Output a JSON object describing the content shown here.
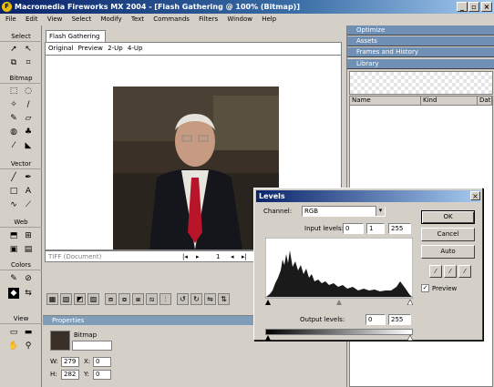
{
  "window": {
    "title": "Macromedia Fireworks MX 2004 - [Flash Gathering @ 100% (Bitmap)]",
    "minimize": "_",
    "restore": "▫",
    "close": "×"
  },
  "menu": [
    "File",
    "Edit",
    "View",
    "Select",
    "Modify",
    "Text",
    "Commands",
    "Filters",
    "Window",
    "Help"
  ],
  "tools": {
    "select": "Select",
    "bitmap": "Bitmap",
    "vector": "Vector",
    "web": "Web",
    "colors": "Colors",
    "view": "View"
  },
  "document": {
    "tab": "Flash Gathering",
    "views": [
      "Original",
      "Preview",
      "2-Up",
      "4-Up"
    ],
    "status_format": "TIFF (Document)",
    "page_number": "1"
  },
  "properties": {
    "header": "Properties",
    "object_type": "Bitmap",
    "w_label": "W:",
    "w_value": "279",
    "h_label": "H:",
    "h_value": "282",
    "x_label": "X:",
    "x_value": "0",
    "y_label": "Y:",
    "y_value": "0"
  },
  "panels": {
    "optimize": "Optimize",
    "assets": "Assets",
    "frames_history": "Frames and History",
    "library": "Library",
    "columns": [
      "Name",
      "Kind",
      "Dat"
    ]
  },
  "levels_dialog": {
    "title": "Levels",
    "channel_label": "Channel:",
    "channel_value": "RGB",
    "input_label": "Input levels:",
    "input_values": [
      "0",
      "1",
      "255"
    ],
    "output_label": "Output levels:",
    "output_values": [
      "0",
      "255"
    ],
    "ok": "OK",
    "cancel": "Cancel",
    "auto": "Auto",
    "preview_label": "Preview",
    "preview_checked": true
  }
}
